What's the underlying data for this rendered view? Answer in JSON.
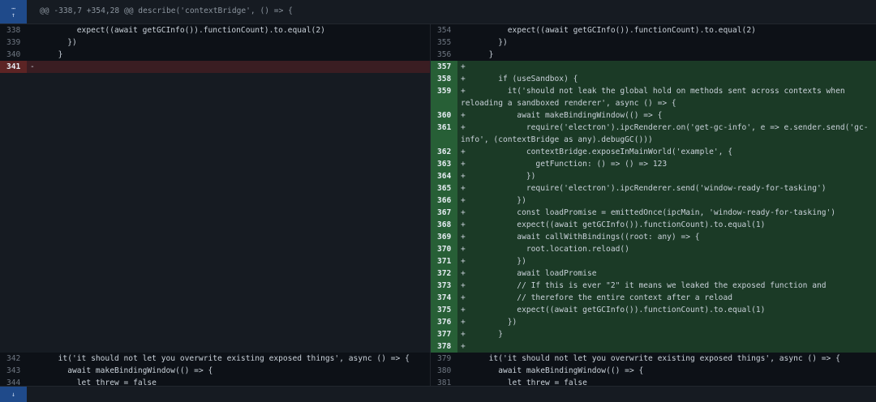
{
  "hunk_header": "@@ -338,7 +354,28 @@ describe('contextBridge', () => {",
  "expand_up_icon": "expand-up-icon",
  "expand_down_icon": "expand-down-icon",
  "left_lines": [
    {
      "n": "338",
      "type": "ctx",
      "text": "          expect((await getGCInfo()).functionCount).to.equal(2)"
    },
    {
      "n": "339",
      "type": "ctx",
      "text": "        })"
    },
    {
      "n": "340",
      "type": "ctx",
      "text": "      }"
    },
    {
      "n": "341",
      "type": "del",
      "text": "-"
    }
  ],
  "left_tail": [
    {
      "n": "342",
      "type": "ctx",
      "text": "      it('it should not let you overwrite existing exposed things', async () => {"
    },
    {
      "n": "343",
      "type": "ctx",
      "text": "        await makeBindingWindow(() => {"
    },
    {
      "n": "344",
      "type": "ctx",
      "text": "          let threw = false"
    }
  ],
  "right_lines": [
    {
      "n": "354",
      "type": "ctx",
      "text": "          expect((await getGCInfo()).functionCount).to.equal(2)"
    },
    {
      "n": "355",
      "type": "ctx",
      "text": "        })"
    },
    {
      "n": "356",
      "type": "ctx",
      "text": "      }"
    },
    {
      "n": "357",
      "type": "add",
      "text": "+"
    },
    {
      "n": "358",
      "type": "add",
      "text": "+       if (useSandbox) {"
    },
    {
      "n": "359",
      "type": "add",
      "text": "+         it('should not leak the global hold on methods sent across contexts when reloading a sandboxed renderer', async () => {",
      "wrap": true
    },
    {
      "n": "360",
      "type": "add",
      "text": "+           await makeBindingWindow(() => {"
    },
    {
      "n": "361",
      "type": "add",
      "text": "+             require('electron').ipcRenderer.on('get-gc-info', e => e.sender.send('gc-info', (contextBridge as any).debugGC()))",
      "wrap": true
    },
    {
      "n": "362",
      "type": "add",
      "text": "+             contextBridge.exposeInMainWorld('example', {"
    },
    {
      "n": "363",
      "type": "add",
      "text": "+               getFunction: () => () => 123"
    },
    {
      "n": "364",
      "type": "add",
      "text": "+             })"
    },
    {
      "n": "365",
      "type": "add",
      "text": "+             require('electron').ipcRenderer.send('window-ready-for-tasking')"
    },
    {
      "n": "366",
      "type": "add",
      "text": "+           })"
    },
    {
      "n": "367",
      "type": "add",
      "text": "+           const loadPromise = emittedOnce(ipcMain, 'window-ready-for-tasking')"
    },
    {
      "n": "368",
      "type": "add",
      "text": "+           expect((await getGCInfo()).functionCount).to.equal(1)"
    },
    {
      "n": "369",
      "type": "add",
      "text": "+           await callWithBindings((root: any) => {"
    },
    {
      "n": "370",
      "type": "add",
      "text": "+             root.location.reload()"
    },
    {
      "n": "371",
      "type": "add",
      "text": "+           })"
    },
    {
      "n": "372",
      "type": "add",
      "text": "+           await loadPromise"
    },
    {
      "n": "373",
      "type": "add",
      "text": "+           // If this is ever \"2\" it means we leaked the exposed function and"
    },
    {
      "n": "374",
      "type": "add",
      "text": "+           // therefore the entire context after a reload"
    },
    {
      "n": "375",
      "type": "add",
      "text": "+           expect((await getGCInfo()).functionCount).to.equal(1)"
    },
    {
      "n": "376",
      "type": "add",
      "text": "+         })"
    },
    {
      "n": "377",
      "type": "add",
      "text": "+       }"
    },
    {
      "n": "378",
      "type": "add",
      "text": "+"
    },
    {
      "n": "379",
      "type": "ctx",
      "text": "      it('it should not let you overwrite existing exposed things', async () => {"
    },
    {
      "n": "380",
      "type": "ctx",
      "text": "        await makeBindingWindow(() => {"
    },
    {
      "n": "381",
      "type": "ctx",
      "text": "          let threw = false"
    }
  ]
}
